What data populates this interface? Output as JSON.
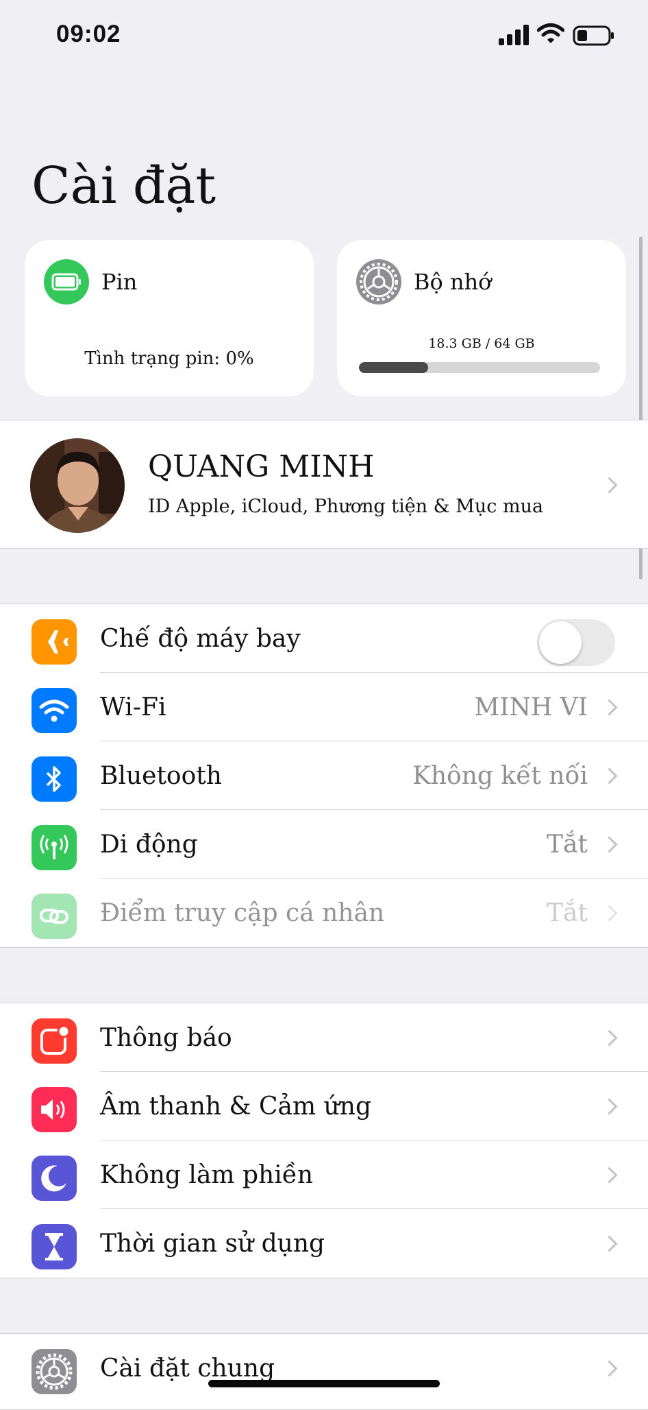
{
  "status_bar": {
    "time": "09:02",
    "icons": [
      "cellular-signal-icon",
      "wifi-icon",
      "battery-icon"
    ]
  },
  "title": "Cài đặt",
  "widgets": {
    "battery": {
      "label": "Pin",
      "status": "Tình trạng pin: 0%",
      "icon": "battery-icon",
      "color": "#34c759"
    },
    "storage": {
      "label": "Bộ nhớ",
      "usage": "18.3 GB / 64 GB",
      "used_fraction": 0.286,
      "icon": "gear-icon"
    }
  },
  "profile": {
    "name": "QUANG MINH",
    "subtitle": "ID Apple, iCloud, Phương tiện & Mục mua"
  },
  "section_connectivity": [
    {
      "label": "Chế độ máy bay",
      "icon": "airplane-icon",
      "color": "#ff9500",
      "toggle": false
    },
    {
      "label": "Wi-Fi",
      "value": "MINH VI",
      "icon": "wifi-icon",
      "color": "#007aff"
    },
    {
      "label": "Bluetooth",
      "value": "Không kết nối",
      "icon": "bluetooth-icon",
      "color": "#007aff"
    },
    {
      "label": "Di động",
      "value": "Tắt",
      "icon": "antenna-icon",
      "color": "#34c759"
    },
    {
      "label": "Điểm truy cập cá nhân",
      "value": "Tắt",
      "icon": "hotspot-icon",
      "color": "#34c759",
      "disabled": true
    }
  ],
  "section_notifications": [
    {
      "label": "Thông báo",
      "icon": "notification-icon",
      "color": "#ff3b30"
    },
    {
      "label": "Âm thanh & Cảm ứng",
      "icon": "speaker-icon",
      "color": "#ff2d55"
    },
    {
      "label": "Không làm phiền",
      "icon": "moon-icon",
      "color": "#5856d6"
    },
    {
      "label": "Thời gian sử dụng",
      "icon": "hourglass-icon",
      "color": "#5856d6"
    }
  ],
  "section_general": [
    {
      "label": "Cài đặt chung",
      "icon": "gear-icon",
      "color": "#8e8e93"
    }
  ]
}
